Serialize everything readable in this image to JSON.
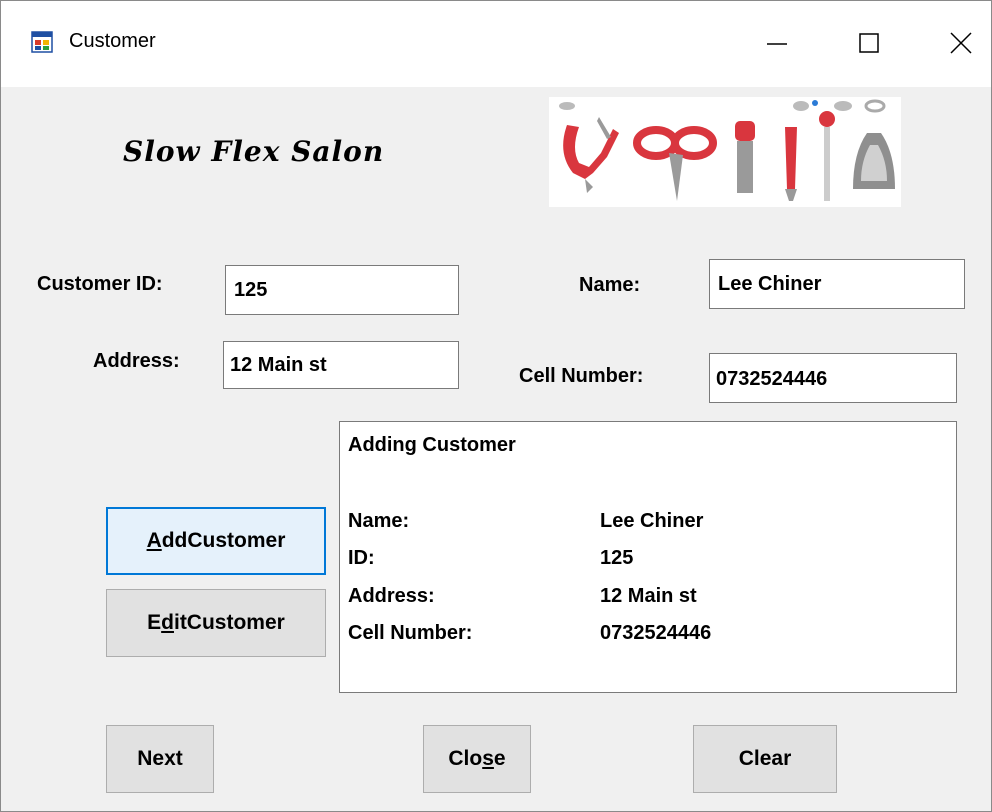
{
  "window": {
    "title": "Customer",
    "controls": [
      "minimize-icon",
      "maximize-icon",
      "close-icon"
    ]
  },
  "brand": {
    "title": "Slow Flex Salon"
  },
  "form": {
    "customer_id": {
      "label": "Customer ID:",
      "value": "125"
    },
    "name": {
      "label": "Name:",
      "value": "Lee Chiner"
    },
    "address": {
      "label": "Address:",
      "value": "12 Main st"
    },
    "cell": {
      "label": "Cell Number:",
      "value": "0732524446"
    }
  },
  "output": {
    "heading": "Adding Customer",
    "rows": [
      {
        "label": "Name:",
        "value": "Lee Chiner"
      },
      {
        "label": "ID:",
        "value": "125"
      },
      {
        "label": "Address:",
        "value": "12 Main st"
      },
      {
        "label": "Cell Number:",
        "value": "0732524446"
      }
    ]
  },
  "buttons": {
    "add": {
      "mnemonic": "A",
      "rest": "ddCustomer"
    },
    "edit": {
      "first": "E",
      "mnemonic": "d",
      "rest": "itCustomer"
    },
    "next": {
      "label": "Next"
    },
    "close": {
      "first": "Clo",
      "mnemonic": "s",
      "rest": "e"
    },
    "clear": {
      "label": "Clear"
    }
  },
  "colors": {
    "focus_border": "#0078d7",
    "focus_fill": "#e5f1fb",
    "window_bg": "#f0f0f0",
    "tool_red": "#d9363e"
  }
}
